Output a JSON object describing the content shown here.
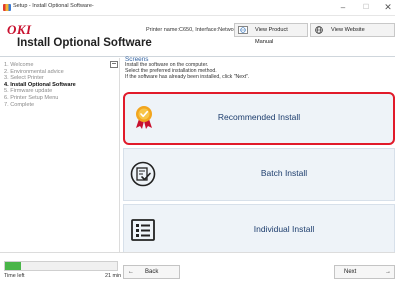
{
  "window": {
    "title": "Setup - Install Optional Software-",
    "min_glyph": "–",
    "max_glyph": "☐",
    "close_glyph": "✕"
  },
  "header": {
    "logo": "OKI",
    "app_title": "Install Optional Software",
    "printer_name": "Printer name:C650, Interface:Network",
    "manual_button": "View Product Manual",
    "website_button": "View Website"
  },
  "sidebar": {
    "steps": [
      "1. Welcome",
      "2. Environmental advice",
      "3. Select Printer",
      "4. Install Optional Software",
      "5. Firmware update",
      "6. Printer Setup Menu",
      "7. Complete"
    ],
    "current_step_index": 3
  },
  "main": {
    "section_title": "Screens",
    "instructions": [
      "Install the software on the computer.",
      "Select the preferred installation method.",
      "If the software has already been installed, click \"Next\"."
    ],
    "options": {
      "recommended": "Recommended Install",
      "batch": "Batch Install",
      "individual": "Individual Install"
    }
  },
  "footer": {
    "progress_fraction": 0.14,
    "time_left_label": "Time left",
    "time_left_value": "21 min",
    "back_label": "Back",
    "next_label": "Next",
    "back_arrow": "←",
    "next_arrow": "→"
  },
  "colors": {
    "accent_red": "#e11a2a",
    "brand_red": "#c8102e",
    "link_blue": "#2e5f9f",
    "progress_green": "#49b548",
    "option_bg": "#eef3f8"
  },
  "icons": {
    "manual": "globe-book-icon",
    "website": "globe-icon",
    "recommended": "award-ribbon-icon",
    "batch": "checklist-circle-icon",
    "individual": "list-icon"
  }
}
